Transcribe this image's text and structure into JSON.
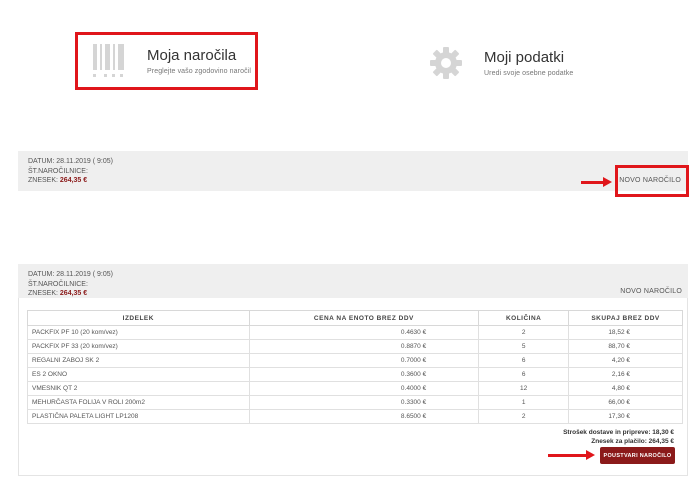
{
  "cards": {
    "orders": {
      "title": "Moja naročila",
      "subtitle": "Preglejte vašo zgodovino naročil",
      "icon": "barcode-icon"
    },
    "profile": {
      "title": "Moji podatki",
      "subtitle": "Uredi svoje osebne podatke",
      "icon": "gear-icon"
    }
  },
  "order1": {
    "date_label": "DATUM: 28.11.2019 ( 9:05)",
    "invoice_label": "ŠT.NAROČILNICE:",
    "amount_label": "ZNESEK:",
    "amount_value": "264,35 €",
    "new_order": "NOVO NAROČILO"
  },
  "order2": {
    "date_label": "DATUM: 28.11.2019 ( 9:05)",
    "invoice_label": "ŠT.NAROČILNICE:",
    "amount_label": "ZNESEK:",
    "amount_value": "264,35 €",
    "new_order": "NOVO NAROČILO"
  },
  "table": {
    "headers": [
      "IZDELEK",
      "CENA NA ENOTO BREZ DDV",
      "KOLIČINA",
      "SKUPAJ BREZ DDV"
    ],
    "rows": [
      [
        "PACKFIX PF 10 (20 kom/vez)",
        "0.4630 €",
        "2",
        "18,52 €"
      ],
      [
        "PACKFIX PF 33 (20 kom/vez)",
        "0.8870 €",
        "5",
        "88,70 €"
      ],
      [
        "REGALNI ZABOJ SK 2",
        "0.7000 €",
        "6",
        "4,20 €"
      ],
      [
        "ES 2 OKNO",
        "0.3600 €",
        "6",
        "2,16 €"
      ],
      [
        "VMESNIK QT 2",
        "0.4000 €",
        "12",
        "4,80 €"
      ],
      [
        "MEHURČASTA FOLIJA V ROLI 200m2",
        "0.3300 €",
        "1",
        "66,00 €"
      ],
      [
        "PLASTIČNA PALETA LIGHT LP1208",
        "8.6500 €",
        "2",
        "17,30 €"
      ]
    ]
  },
  "summary": {
    "shipping": "Strošek dostave in pripreve: 18,30 €",
    "total": "Znesek za plačilo: 264,35 €",
    "confirm_button": "POUSTVARI NAROČILO"
  },
  "colors": {
    "accent": "#8b1a1a",
    "highlight": "#e0161b",
    "bar": "#efefef"
  }
}
